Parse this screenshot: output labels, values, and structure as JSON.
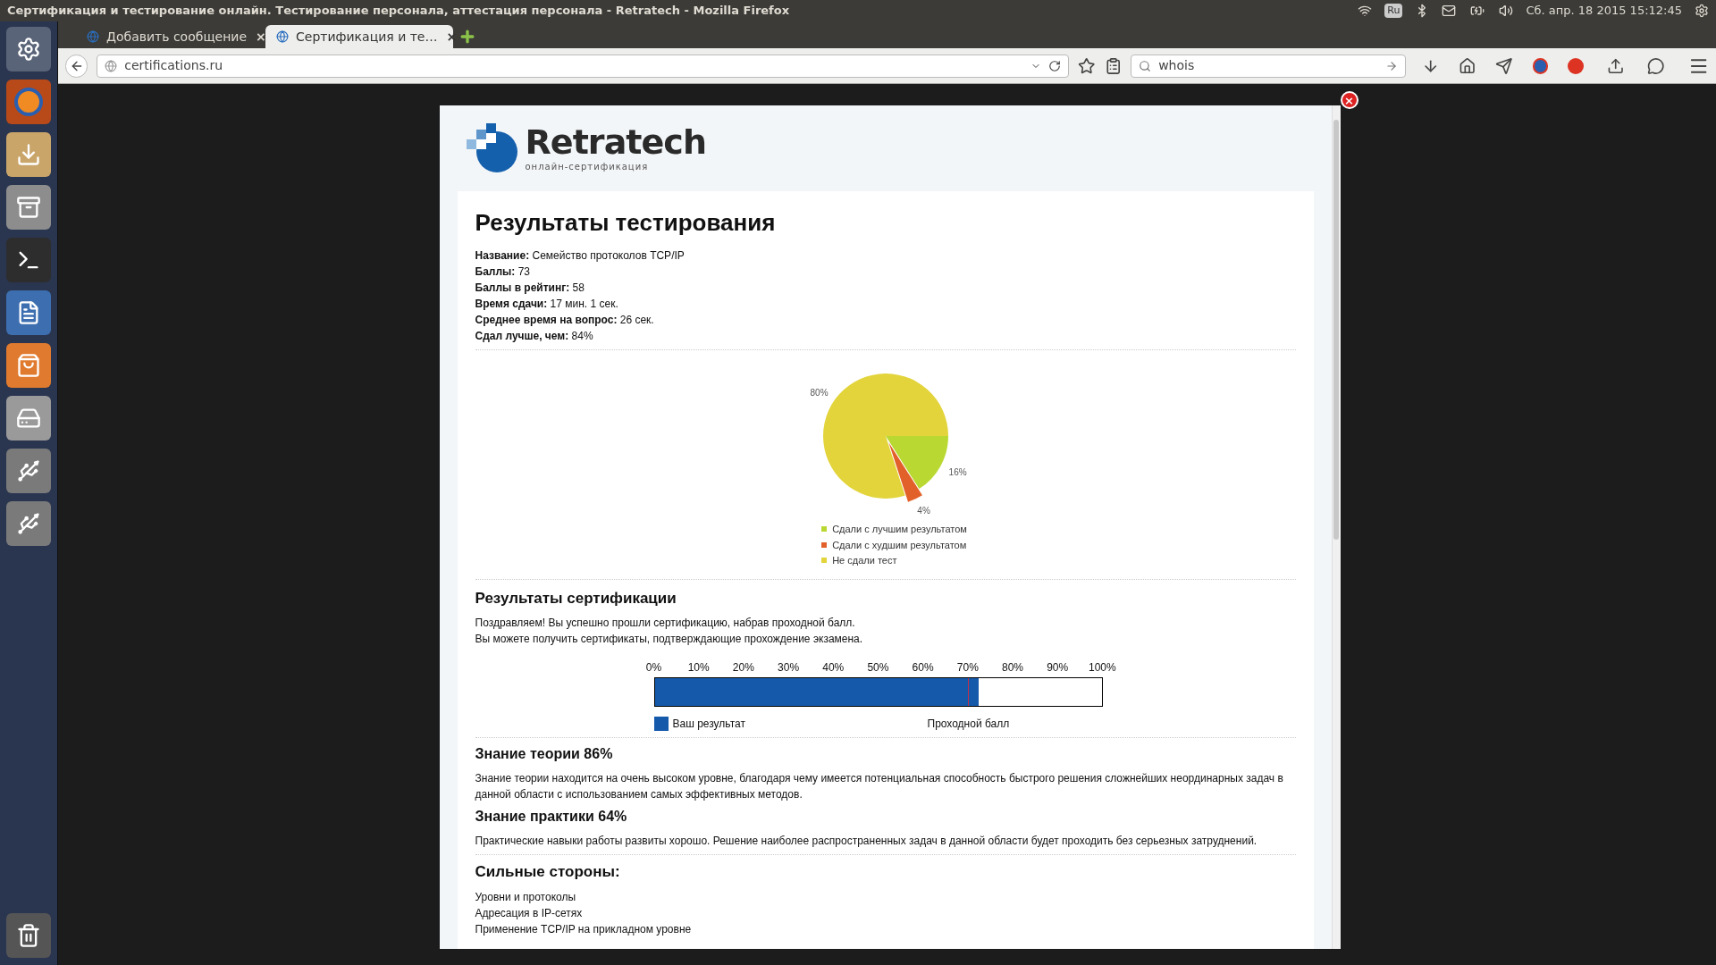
{
  "top_panel": {
    "title": "Сертификация и тестирование онлайн. Тестирование персонала, аттестация персонала - Retratech - Mozilla Firefox",
    "keyboard": "Ru",
    "clock": "Сб. апр. 18 2015 15:12:45"
  },
  "tabs": [
    {
      "label": "Добавить сообщение",
      "selected": false,
      "close": "×"
    },
    {
      "label": "Сертификация и те…",
      "selected": true,
      "close": "×"
    }
  ],
  "address_bar": {
    "value": "certifications.ru"
  },
  "search": {
    "value": "whois"
  },
  "modal": {
    "close": "×",
    "logo": {
      "name": "Retratech",
      "tagline": "онлайн-сертификация"
    },
    "title": "Результаты тестирования",
    "info": [
      {
        "label": "Название:",
        "value": "Семейство протоколов TCP/IP"
      },
      {
        "label": "Баллы:",
        "value": "73"
      },
      {
        "label": "Баллы в рейтинг:",
        "value": "58"
      },
      {
        "label": "Время сдачи:",
        "value": "17 мин. 1 сек."
      },
      {
        "label": "Среднее время на вопрос:",
        "value": "26 сек."
      },
      {
        "label": "Сдал лучше, чем:",
        "value": "84%"
      }
    ],
    "chart_data": {
      "type": "pie",
      "categories": [
        "Сдали с лучшим результатом",
        "Сдали с худшим результатом",
        "Не сдали тест"
      ],
      "values": [
        16,
        4,
        80
      ],
      "colors": [
        "#b9d832",
        "#e2612b",
        "#e2d43a"
      ],
      "value_labels": [
        "16%",
        "4%",
        "80%"
      ],
      "legend": "bottom"
    },
    "cert": {
      "title": "Результаты сертификации",
      "text": [
        "Поздравляем! Вы успешно прошли сертификацию, набрав проходной балл.",
        "Вы можете получить сертификаты, подтверждающие прохождение экзамена."
      ],
      "ticks": [
        "0%",
        "10%",
        "20%",
        "30%",
        "40%",
        "50%",
        "60%",
        "70%",
        "80%",
        "90%",
        "100%"
      ],
      "result": {
        "level": 0.725,
        "label": "Ваш результат"
      },
      "pass_mark": {
        "level": 0.7,
        "label": "Проходной балл"
      }
    },
    "sections": [
      {
        "title": "Знание теории 86%",
        "text": "Знание теории находится на очень высоком уровне, благодаря чему имеется потенциальная способность быстрого решения сложнейших неординарных задач в данной области с использованием самых эффективных методов."
      },
      {
        "title": "Знание практики 64%",
        "text": "Практические навыки работы развиты хорошо. Решение наиболее распространенных задач в данной области будет проходить без серьезных затруднений."
      }
    ],
    "strengths": {
      "title": "Сильные стороны:",
      "items": [
        "Уровни и протоколы",
        "Адресация в IP-сетях",
        "Применение TCP/IP на прикладном уровне"
      ]
    }
  }
}
